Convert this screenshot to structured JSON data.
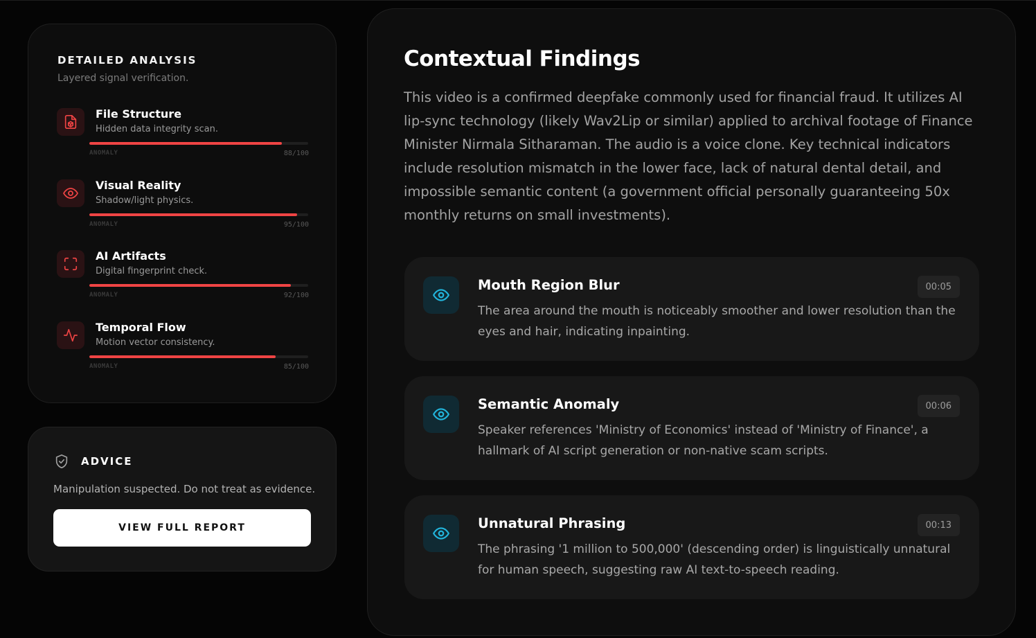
{
  "analysis": {
    "title": "DETAILED ANALYSIS",
    "subtitle": "Layered signal verification.",
    "metrics": [
      {
        "name": "File Structure",
        "desc": "Hidden data integrity scan.",
        "tag": "ANOMALY",
        "score_text": "88/100",
        "score": 88,
        "icon": "file-box-icon"
      },
      {
        "name": "Visual Reality",
        "desc": "Shadow/light physics.",
        "tag": "ANOMALY",
        "score_text": "95/100",
        "score": 95,
        "icon": "eye-icon"
      },
      {
        "name": "AI Artifacts",
        "desc": "Digital fingerprint check.",
        "tag": "ANOMALY",
        "score_text": "92/100",
        "score": 92,
        "icon": "scan-frame-icon"
      },
      {
        "name": "Temporal Flow",
        "desc": "Motion vector consistency.",
        "tag": "ANOMALY",
        "score_text": "85/100",
        "score": 85,
        "icon": "activity-pulse-icon"
      }
    ]
  },
  "advice": {
    "title": "ADVICE",
    "text": "Manipulation suspected. Do not treat as evidence.",
    "button_label": "VIEW FULL REPORT",
    "icon": "shield-check-icon"
  },
  "findings": {
    "title": "Contextual Findings",
    "summary": "This video is a confirmed deepfake commonly used for financial fraud. It utilizes AI lip-sync technology (likely Wav2Lip or similar) applied to archival footage of Finance Minister Nirmala Sitharaman. The audio is a voice clone. Key technical indicators include resolution mismatch in the lower face, lack of natural dental detail, and impossible semantic content (a government official personally guaranteeing 50x monthly returns on small investments).",
    "items": [
      {
        "title": "Mouth Region Blur",
        "time": "00:05",
        "desc": "The area around the mouth is noticeably smoother and lower resolution than the eyes and hair, indicating inpainting.",
        "icon": "eye-icon"
      },
      {
        "title": "Semantic Anomaly",
        "time": "00:06",
        "desc": "Speaker references 'Ministry of Economics' instead of 'Ministry of Finance', a hallmark of AI script generation or non-native scam scripts.",
        "icon": "eye-icon"
      },
      {
        "title": "Unnatural Phrasing",
        "time": "00:13",
        "desc": "The phrasing '1 million to 500,000' (descending order) is linguistically unnatural for human speech, suggesting raw AI text-to-speech reading.",
        "icon": "eye-icon"
      }
    ]
  },
  "colors": {
    "background": "#050505",
    "anomaly_red": "#ef4444",
    "finding_accent": "#22b5dc",
    "card": "#0d0d0d"
  }
}
